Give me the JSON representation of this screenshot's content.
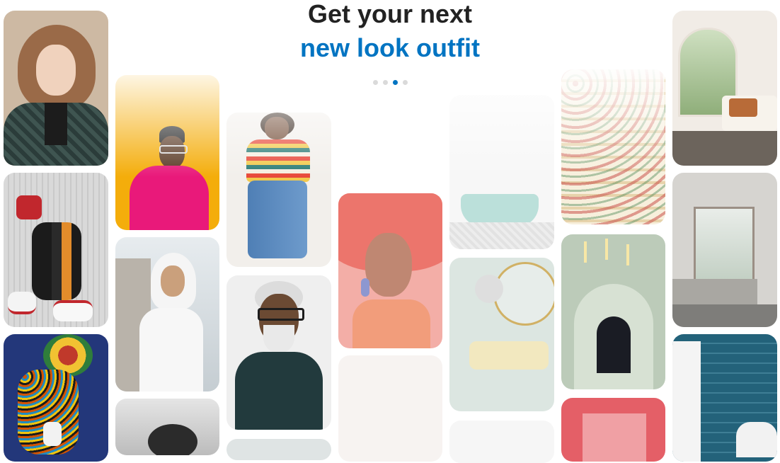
{
  "headline": {
    "line1": "Get your next",
    "line2": "new look outfit",
    "accent_color": "#0074c2"
  },
  "carousel": {
    "dots": 4,
    "active_index": 2
  },
  "pins": [
    {
      "subject": "woman-curly-hair-plaid-blazer"
    },
    {
      "subject": "street-style-sneakers"
    },
    {
      "subject": "colorful-patterned-outfit"
    },
    {
      "subject": "man-pink-sweater-yellow-background"
    },
    {
      "subject": "woman-white-hijab"
    },
    {
      "subject": "woman-striped-tee-wide-jeans"
    },
    {
      "subject": "man-grey-beard-glasses"
    },
    {
      "subject": "woman-portrait-red-fabric"
    },
    {
      "subject": "white-bathroom-tub"
    },
    {
      "subject": "mint-living-room-arc-lamp"
    },
    {
      "subject": "floral-painted-stairs"
    },
    {
      "subject": "arched-hallway-light-rods"
    },
    {
      "subject": "boho-bedroom-arched-window"
    },
    {
      "subject": "minimal-grey-bedroom"
    },
    {
      "subject": "blue-tile-bathroom"
    }
  ]
}
